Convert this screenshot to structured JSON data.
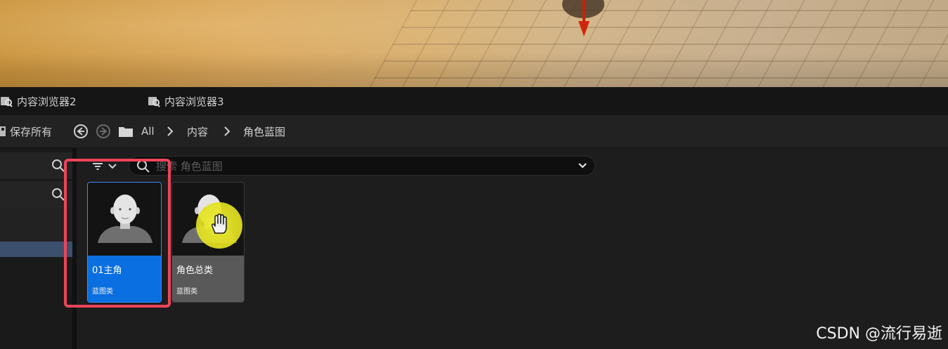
{
  "tabs": [
    {
      "label": "内容浏览器2",
      "icon": "content-browser-icon"
    },
    {
      "label": "内容浏览器3",
      "icon": "content-browser-icon"
    }
  ],
  "toolbar": {
    "save_all_label": "保存所有",
    "breadcrumb": [
      "All",
      "内容",
      "角色蓝图"
    ]
  },
  "search": {
    "placeholder": "搜索 角色蓝图"
  },
  "assets": [
    {
      "name": "01主角",
      "type": "蓝图类",
      "selected": true
    },
    {
      "name": "角色总类",
      "type": "蓝图类",
      "selected": false
    }
  ],
  "colors": {
    "selection_blue": "#0a6fe0",
    "highlight_red": "#ee4459",
    "cursor_yellow": "#e7e522"
  },
  "watermark": "CSDN @流行易逝"
}
